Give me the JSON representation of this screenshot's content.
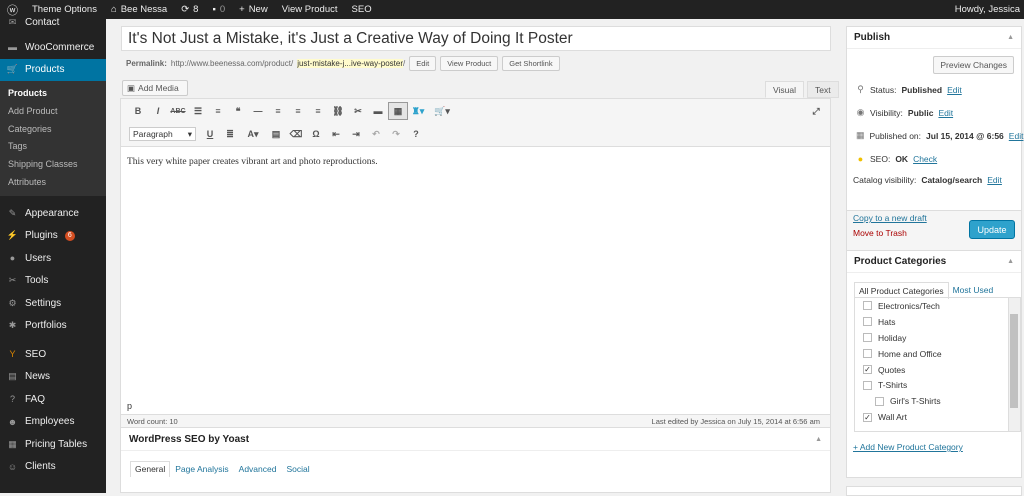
{
  "admin_bar": {
    "wp": "",
    "theme_options": "Theme Options",
    "site": "Bee Nessa",
    "updates": "8",
    "comments": "0",
    "new": "New",
    "view_product": "View Product",
    "seo": "SEO",
    "howdy": "Howdy, Jessica"
  },
  "sidebar": {
    "contact": "Contact",
    "woocommerce": "WooCommerce",
    "products": "Products",
    "sub": [
      "Products",
      "Add Product",
      "Categories",
      "Tags",
      "Shipping Classes",
      "Attributes"
    ],
    "appearance": "Appearance",
    "plugins": "Plugins",
    "plugins_badge": "6",
    "users": "Users",
    "tools": "Tools",
    "settings": "Settings",
    "portfolios": "Portfolios",
    "seo": "SEO",
    "news": "News",
    "faq": "FAQ",
    "employees": "Employees",
    "pricing_tables": "Pricing Tables",
    "clients": "Clients"
  },
  "editor": {
    "title": "It's Not Just a Mistake, it's Just a Creative Way of Doing It Poster",
    "permalink_label": "Permalink:",
    "permalink_base": "http://www.beenessa.com/product/",
    "permalink_slug": "just-mistake-j...ive-way-poster",
    "permalink_end": "/",
    "edit": "Edit",
    "view_product": "View Product",
    "get_shortlink": "Get Shortlink",
    "add_media": "Add Media",
    "tab_visual": "Visual",
    "tab_text": "Text",
    "format": "Paragraph",
    "content": "This very white paper creates vibrant art and photo reproductions.",
    "path": "p",
    "word_count": "Word count: 10",
    "last_edited": "Last edited by Jessica on July 15, 2014 at 6:56 am"
  },
  "yoast": {
    "title": "WordPress SEO by Yoast",
    "tabs": [
      "General",
      "Page Analysis",
      "Advanced",
      "Social"
    ]
  },
  "publish": {
    "title": "Publish",
    "preview": "Preview Changes",
    "status_label": "Status:",
    "status": "Published",
    "visibility_label": "Visibility:",
    "visibility": "Public",
    "published_label": "Published on:",
    "published": "Jul 15, 2014 @ 6:56",
    "seo_label": "SEO:",
    "seo": "OK",
    "check": "Check",
    "catalog_label": "Catalog visibility:",
    "catalog": "Catalog/search",
    "edit": "Edit",
    "copy": "Copy to a new draft",
    "trash": "Move to Trash",
    "update": "Update"
  },
  "categories": {
    "title": "Product Categories",
    "tab_all": "All Product Categories",
    "tab_used": "Most Used",
    "items": [
      {
        "label": "Electronics/Tech",
        "checked": false
      },
      {
        "label": "Hats",
        "checked": false
      },
      {
        "label": "Holiday",
        "checked": false
      },
      {
        "label": "Home and Office",
        "checked": false
      },
      {
        "label": "Quotes",
        "checked": true
      },
      {
        "label": "T-Shirts",
        "checked": false
      },
      {
        "label": "Girl's T-Shirts",
        "checked": false,
        "child": true
      },
      {
        "label": "Wall Art",
        "checked": true
      }
    ],
    "add_new": "+ Add New Product Category"
  }
}
